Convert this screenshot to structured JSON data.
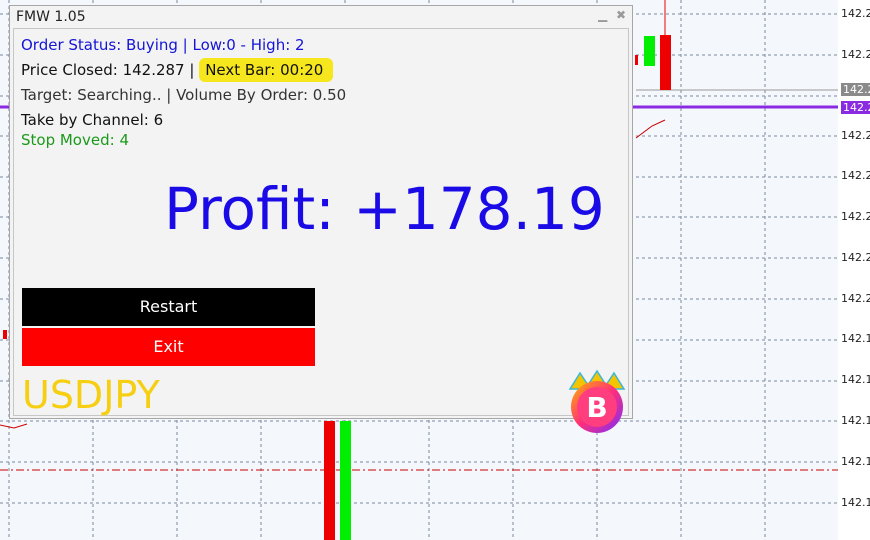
{
  "panel": {
    "title": "FMW 1.05",
    "minimize_icon": "minimize-icon",
    "close_icon": "close-icon",
    "order_status": "Order Status: Buying | Low:0 - High: 2",
    "price_closed": "Price Closed: 142.287 |",
    "next_bar": "Next Bar: 00:20",
    "target": "Target: Searching.. | Volume By Order: 0.50",
    "take_by_channel": "Take by Channel: 6",
    "stop_moved": "Stop Moved: 4",
    "profit": "Profit: +178.19",
    "restart_label": "Restart",
    "exit_label": "Exit",
    "symbol": "USDJPY",
    "logo_icon": "bitcoin-crown-icon",
    "logo_glyph": "B"
  },
  "price_axis": {
    "ticks": [
      "142.2",
      "142.2",
      "142.2",
      "142.2",
      "142.2",
      "142.2",
      "142.2",
      "142.2",
      "142.1",
      "142.1",
      "142.1",
      "142.1",
      "142.1"
    ],
    "current_price_tag": "142.2",
    "bid_tag": "142.2"
  },
  "colors": {
    "order_status": "#1414d6",
    "stop_moved": "#1a9a1a",
    "profit": "#1a0be6",
    "restart_bg": "#000000",
    "exit_bg": "#ff0000",
    "symbol": "#f6cf13",
    "highlight": "#f5e61d",
    "bid_line": "#8a2be2",
    "bull_candle": "#00ee00",
    "bear_candle": "#ee0000"
  }
}
